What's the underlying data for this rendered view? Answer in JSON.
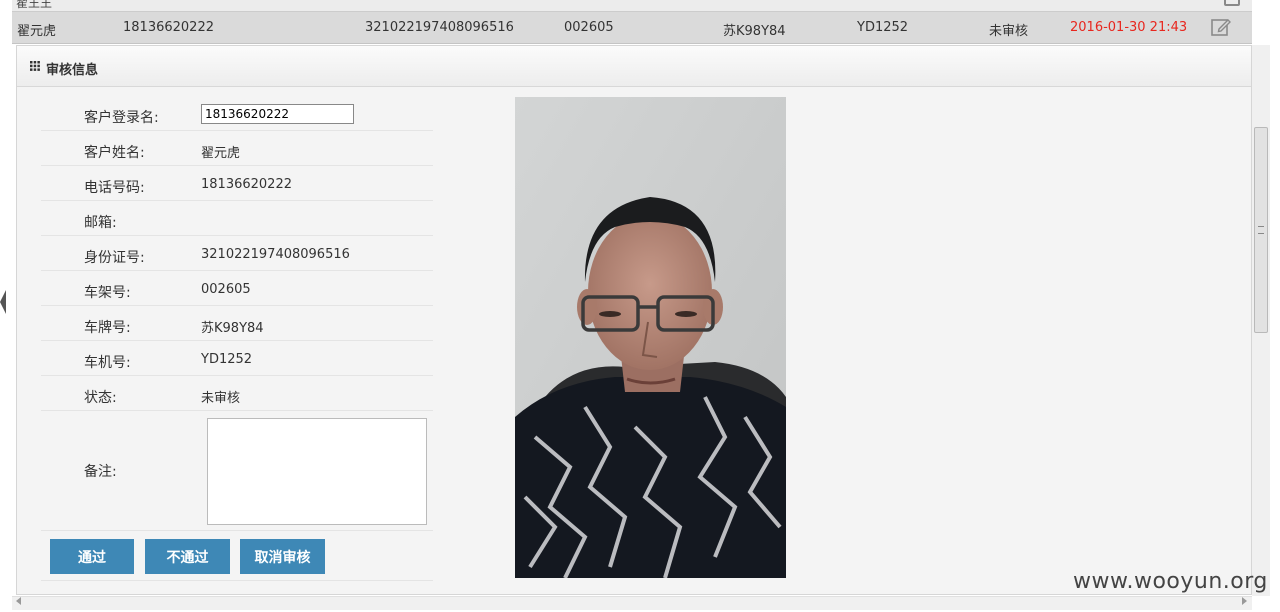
{
  "top_row": {
    "name": "翟王王"
  },
  "record_row": {
    "name": "翟元虎",
    "login": "18136620222",
    "id_number": "321022197408096516",
    "frame_no": "002605",
    "plate_no": "苏K98Y84",
    "engine_no": "YD1252",
    "status": "未审核",
    "datetime": "2016-01-30 21:43"
  },
  "panel": {
    "title": "审核信息",
    "fields": [
      {
        "label": "客户登录名:",
        "value": "18136620222"
      },
      {
        "label": "客户姓名:",
        "value": "翟元虎"
      },
      {
        "label": "电话号码:",
        "value": "18136620222"
      },
      {
        "label": "邮箱:",
        "value": ""
      },
      {
        "label": "身份证号:",
        "value": "321022197408096516"
      },
      {
        "label": "车架号:",
        "value": "002605"
      },
      {
        "label": "车牌号:",
        "value": "苏K98Y84"
      },
      {
        "label": "车机号:",
        "value": "YD1252"
      },
      {
        "label": "状态:",
        "value": "未审核"
      }
    ],
    "remark_label": "备注:",
    "remark_value": "",
    "buttons": {
      "approve": "通过",
      "reject": "不通过",
      "cancel": "取消审核"
    }
  },
  "watermark": "www.wooyun.org",
  "colors": {
    "date": "#e8261e",
    "button": "#3e88b6"
  }
}
